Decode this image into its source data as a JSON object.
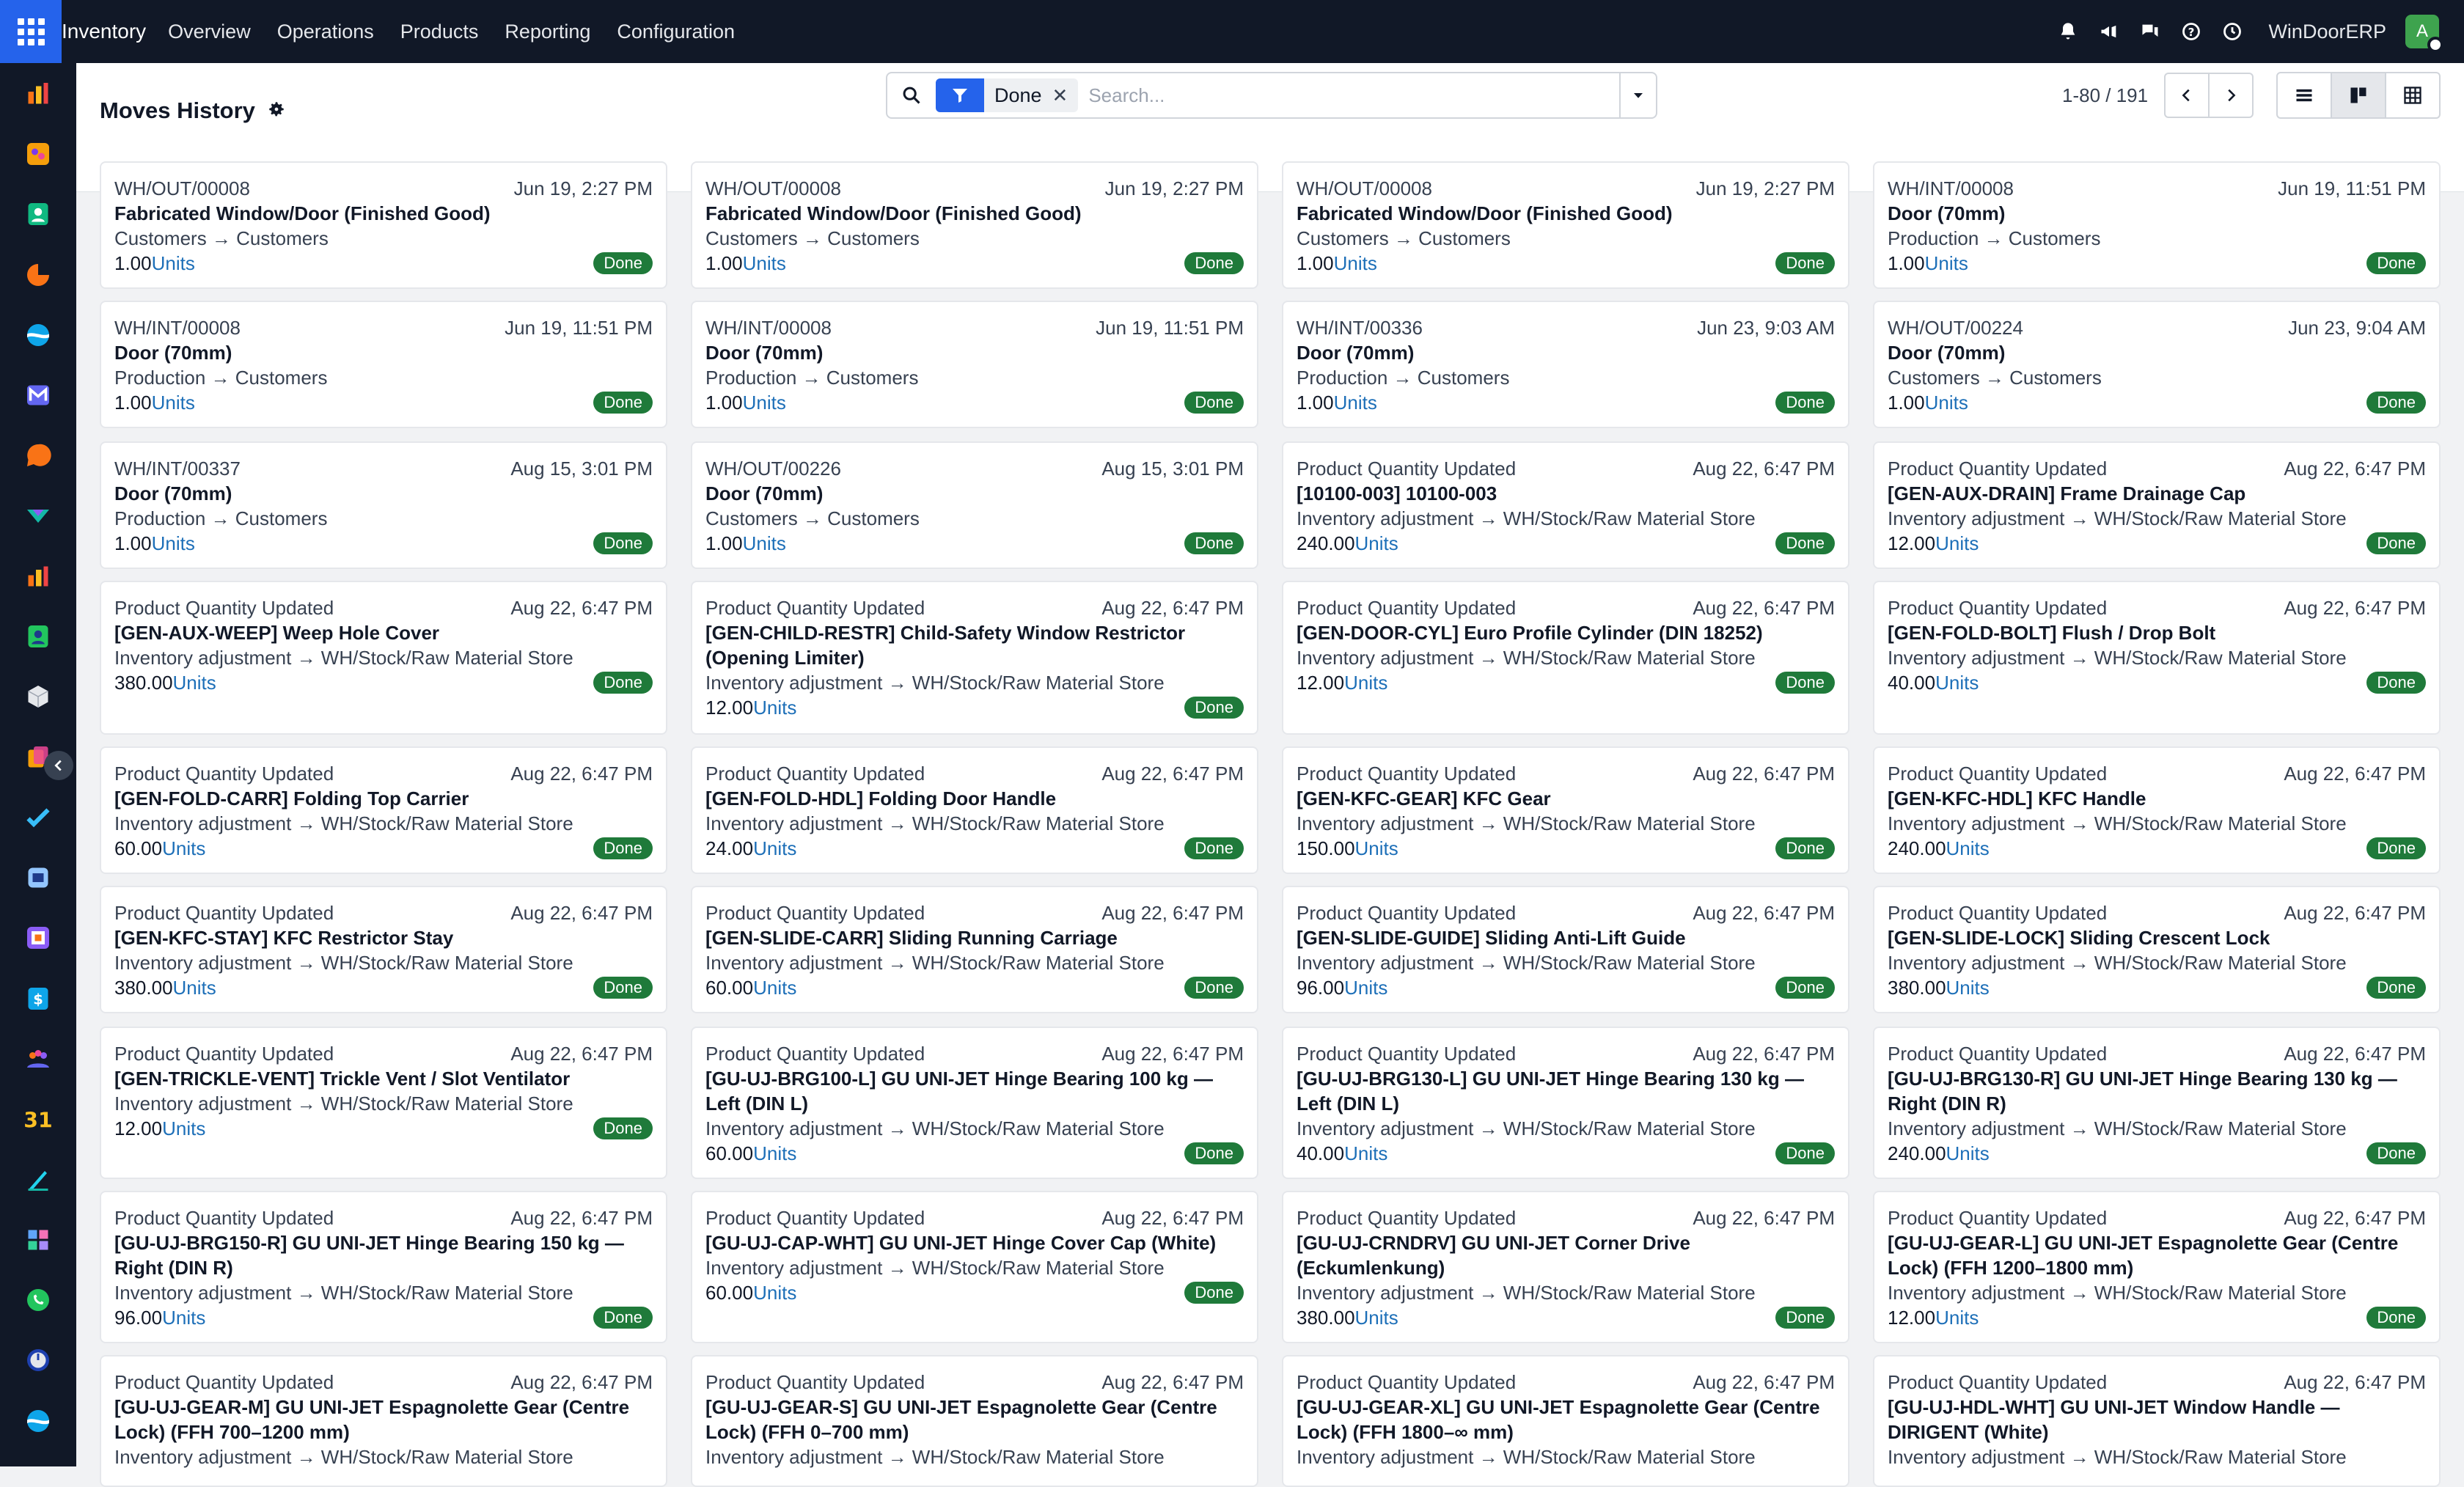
{
  "navbar": {
    "brand": "Inventory",
    "menu": [
      "Overview",
      "Operations",
      "Products",
      "Reporting",
      "Configuration"
    ],
    "company": "WinDoorERP",
    "avatar_letter": "A",
    "icons": [
      "bell-icon",
      "megaphone-icon",
      "chat-icon",
      "help-icon",
      "clock-icon"
    ]
  },
  "dock": {
    "apps": [
      "dashboard-icon",
      "discuss-icon",
      "contacts-icon",
      "crm-icon",
      "sales-icon",
      "email-marketing-icon",
      "helpdesk-icon",
      "field-service-icon",
      "reporting-icon",
      "employees-icon",
      "inventory-icon",
      "documents-icon",
      "todo-icon",
      "knowledge-icon",
      "barcode-icon",
      "accounting-icon",
      "team-icon",
      "calendar-icon",
      "sign-icon",
      "apps-icon",
      "whatsapp-icon",
      "timer-icon",
      "studio-icon"
    ]
  },
  "control": {
    "title": "Moves History",
    "facet_label": "Done",
    "search_placeholder": "Search...",
    "pager_text": "1-80 / 191"
  },
  "cards": [
    {
      "ref": "WH/OUT/00008",
      "date": "Jun 19, 2:27 PM",
      "product": "Fabricated Window/Door (Finished Good)",
      "location": "Customers → Customers",
      "qty": "1.00",
      "uom": "Units",
      "status": "Done"
    },
    {
      "ref": "WH/OUT/00008",
      "date": "Jun 19, 2:27 PM",
      "product": "Fabricated Window/Door (Finished Good)",
      "location": "Customers → Customers",
      "qty": "1.00",
      "uom": "Units",
      "status": "Done"
    },
    {
      "ref": "WH/OUT/00008",
      "date": "Jun 19, 2:27 PM",
      "product": "Fabricated Window/Door (Finished Good)",
      "location": "Customers → Customers",
      "qty": "1.00",
      "uom": "Units",
      "status": "Done"
    },
    {
      "ref": "WH/INT/00008",
      "date": "Jun 19, 11:51 PM",
      "product": "Door (70mm)",
      "location": "Production → Customers",
      "qty": "1.00",
      "uom": "Units",
      "status": "Done"
    },
    {
      "ref": "WH/INT/00008",
      "date": "Jun 19, 11:51 PM",
      "product": "Door (70mm)",
      "location": "Production → Customers",
      "qty": "1.00",
      "uom": "Units",
      "status": "Done"
    },
    {
      "ref": "WH/INT/00008",
      "date": "Jun 19, 11:51 PM",
      "product": "Door (70mm)",
      "location": "Production → Customers",
      "qty": "1.00",
      "uom": "Units",
      "status": "Done"
    },
    {
      "ref": "WH/INT/00336",
      "date": "Jun 23, 9:03 AM",
      "product": "Door (70mm)",
      "location": "Production → Customers",
      "qty": "1.00",
      "uom": "Units",
      "status": "Done"
    },
    {
      "ref": "WH/OUT/00224",
      "date": "Jun 23, 9:04 AM",
      "product": "Door (70mm)",
      "location": "Customers → Customers",
      "qty": "1.00",
      "uom": "Units",
      "status": "Done"
    },
    {
      "ref": "WH/INT/00337",
      "date": "Aug 15, 3:01 PM",
      "product": "Door (70mm)",
      "location": "Production → Customers",
      "qty": "1.00",
      "uom": "Units",
      "status": "Done"
    },
    {
      "ref": "WH/OUT/00226",
      "date": "Aug 15, 3:01 PM",
      "product": "Door (70mm)",
      "location": "Customers → Customers",
      "qty": "1.00",
      "uom": "Units",
      "status": "Done"
    },
    {
      "ref": "Product Quantity Updated",
      "date": "Aug 22, 6:47 PM",
      "product": "[10100-003] 10100-003",
      "location": "Inventory adjustment → WH/Stock/Raw Material Store",
      "qty": "240.00",
      "uom": "Units",
      "status": "Done"
    },
    {
      "ref": "Product Quantity Updated",
      "date": "Aug 22, 6:47 PM",
      "product": "[GEN-AUX-DRAIN] Frame Drainage Cap",
      "location": "Inventory adjustment → WH/Stock/Raw Material Store",
      "qty": "12.00",
      "uom": "Units",
      "status": "Done"
    },
    {
      "ref": "Product Quantity Updated",
      "date": "Aug 22, 6:47 PM",
      "product": "[GEN-AUX-WEEP] Weep Hole Cover",
      "location": "Inventory adjustment → WH/Stock/Raw Material Store",
      "qty": "380.00",
      "uom": "Units",
      "status": "Done"
    },
    {
      "ref": "Product Quantity Updated",
      "date": "Aug 22, 6:47 PM",
      "product": "[GEN-CHILD-RESTR] Child-Safety Window Restrictor (Opening Limiter)",
      "location": "Inventory adjustment → WH/Stock/Raw Material Store",
      "qty": "12.00",
      "uom": "Units",
      "status": "Done"
    },
    {
      "ref": "Product Quantity Updated",
      "date": "Aug 22, 6:47 PM",
      "product": "[GEN-DOOR-CYL] Euro Profile Cylinder (DIN 18252)",
      "location": "Inventory adjustment → WH/Stock/Raw Material Store",
      "qty": "12.00",
      "uom": "Units",
      "status": "Done"
    },
    {
      "ref": "Product Quantity Updated",
      "date": "Aug 22, 6:47 PM",
      "product": "[GEN-FOLD-BOLT] Flush / Drop Bolt",
      "location": "Inventory adjustment → WH/Stock/Raw Material Store",
      "qty": "40.00",
      "uom": "Units",
      "status": "Done"
    },
    {
      "ref": "Product Quantity Updated",
      "date": "Aug 22, 6:47 PM",
      "product": "[GEN-FOLD-CARR] Folding Top Carrier",
      "location": "Inventory adjustment → WH/Stock/Raw Material Store",
      "qty": "60.00",
      "uom": "Units",
      "status": "Done"
    },
    {
      "ref": "Product Quantity Updated",
      "date": "Aug 22, 6:47 PM",
      "product": "[GEN-FOLD-HDL] Folding Door Handle",
      "location": "Inventory adjustment → WH/Stock/Raw Material Store",
      "qty": "24.00",
      "uom": "Units",
      "status": "Done"
    },
    {
      "ref": "Product Quantity Updated",
      "date": "Aug 22, 6:47 PM",
      "product": "[GEN-KFC-GEAR] KFC Gear",
      "location": "Inventory adjustment → WH/Stock/Raw Material Store",
      "qty": "150.00",
      "uom": "Units",
      "status": "Done"
    },
    {
      "ref": "Product Quantity Updated",
      "date": "Aug 22, 6:47 PM",
      "product": "[GEN-KFC-HDL] KFC Handle",
      "location": "Inventory adjustment → WH/Stock/Raw Material Store",
      "qty": "240.00",
      "uom": "Units",
      "status": "Done"
    },
    {
      "ref": "Product Quantity Updated",
      "date": "Aug 22, 6:47 PM",
      "product": "[GEN-KFC-STAY] KFC Restrictor Stay",
      "location": "Inventory adjustment → WH/Stock/Raw Material Store",
      "qty": "380.00",
      "uom": "Units",
      "status": "Done"
    },
    {
      "ref": "Product Quantity Updated",
      "date": "Aug 22, 6:47 PM",
      "product": "[GEN-SLIDE-CARR] Sliding Running Carriage",
      "location": "Inventory adjustment → WH/Stock/Raw Material Store",
      "qty": "60.00",
      "uom": "Units",
      "status": "Done"
    },
    {
      "ref": "Product Quantity Updated",
      "date": "Aug 22, 6:47 PM",
      "product": "[GEN-SLIDE-GUIDE] Sliding Anti-Lift Guide",
      "location": "Inventory adjustment → WH/Stock/Raw Material Store",
      "qty": "96.00",
      "uom": "Units",
      "status": "Done"
    },
    {
      "ref": "Product Quantity Updated",
      "date": "Aug 22, 6:47 PM",
      "product": "[GEN-SLIDE-LOCK] Sliding Crescent Lock",
      "location": "Inventory adjustment → WH/Stock/Raw Material Store",
      "qty": "380.00",
      "uom": "Units",
      "status": "Done"
    },
    {
      "ref": "Product Quantity Updated",
      "date": "Aug 22, 6:47 PM",
      "product": "[GEN-TRICKLE-VENT] Trickle Vent / Slot Ventilator",
      "location": "Inventory adjustment → WH/Stock/Raw Material Store",
      "qty": "12.00",
      "uom": "Units",
      "status": "Done"
    },
    {
      "ref": "Product Quantity Updated",
      "date": "Aug 22, 6:47 PM",
      "product": "[GU-UJ-BRG100-L] GU UNI-JET Hinge Bearing 100 kg — Left (DIN L)",
      "location": "Inventory adjustment → WH/Stock/Raw Material Store",
      "qty": "60.00",
      "uom": "Units",
      "status": "Done"
    },
    {
      "ref": "Product Quantity Updated",
      "date": "Aug 22, 6:47 PM",
      "product": "[GU-UJ-BRG130-L] GU UNI-JET Hinge Bearing 130 kg — Left (DIN L)",
      "location": "Inventory adjustment → WH/Stock/Raw Material Store",
      "qty": "40.00",
      "uom": "Units",
      "status": "Done"
    },
    {
      "ref": "Product Quantity Updated",
      "date": "Aug 22, 6:47 PM",
      "product": "[GU-UJ-BRG130-R] GU UNI-JET Hinge Bearing 130 kg — Right (DIN R)",
      "location": "Inventory adjustment → WH/Stock/Raw Material Store",
      "qty": "240.00",
      "uom": "Units",
      "status": "Done"
    },
    {
      "ref": "Product Quantity Updated",
      "date": "Aug 22, 6:47 PM",
      "product": "[GU-UJ-BRG150-R] GU UNI-JET Hinge Bearing 150 kg — Right (DIN R)",
      "location": "Inventory adjustment → WH/Stock/Raw Material Store",
      "qty": "96.00",
      "uom": "Units",
      "status": "Done"
    },
    {
      "ref": "Product Quantity Updated",
      "date": "Aug 22, 6:47 PM",
      "product": "[GU-UJ-CAP-WHT] GU UNI-JET Hinge Cover Cap (White)",
      "location": "Inventory adjustment → WH/Stock/Raw Material Store",
      "qty": "60.00",
      "uom": "Units",
      "status": "Done"
    },
    {
      "ref": "Product Quantity Updated",
      "date": "Aug 22, 6:47 PM",
      "product": "[GU-UJ-CRNDRV] GU UNI-JET Corner Drive (Eckumlenkung)",
      "location": "Inventory adjustment → WH/Stock/Raw Material Store",
      "qty": "380.00",
      "uom": "Units",
      "status": "Done"
    },
    {
      "ref": "Product Quantity Updated",
      "date": "Aug 22, 6:47 PM",
      "product": "[GU-UJ-GEAR-L] GU UNI-JET Espagnolette Gear (Centre Lock) (FFH 1200–1800 mm)",
      "location": "Inventory adjustment → WH/Stock/Raw Material Store",
      "qty": "12.00",
      "uom": "Units",
      "status": "Done"
    },
    {
      "ref": "Product Quantity Updated",
      "date": "Aug 22, 6:47 PM",
      "product": "[GU-UJ-GEAR-M] GU UNI-JET Espagnolette Gear (Centre Lock) (FFH 700–1200 mm)",
      "location": "Inventory adjustment → WH/Stock/Raw Material Store",
      "qty": "",
      "uom": "",
      "status": ""
    },
    {
      "ref": "Product Quantity Updated",
      "date": "Aug 22, 6:47 PM",
      "product": "[GU-UJ-GEAR-S] GU UNI-JET Espagnolette Gear (Centre Lock) (FFH 0–700 mm)",
      "location": "Inventory adjustment → WH/Stock/Raw Material Store",
      "qty": "",
      "uom": "",
      "status": ""
    },
    {
      "ref": "Product Quantity Updated",
      "date": "Aug 22, 6:47 PM",
      "product": "[GU-UJ-GEAR-XL] GU UNI-JET Espagnolette Gear (Centre Lock) (FFH 1800–∞ mm)",
      "location": "Inventory adjustment → WH/Stock/Raw Material Store",
      "qty": "",
      "uom": "",
      "status": ""
    },
    {
      "ref": "Product Quantity Updated",
      "date": "Aug 22, 6:47 PM",
      "product": "[GU-UJ-HDL-WHT] GU UNI-JET Window Handle — DIRIGENT (White)",
      "location": "Inventory adjustment → WH/Stock/Raw Material Store",
      "qty": "",
      "uom": "",
      "status": ""
    }
  ]
}
